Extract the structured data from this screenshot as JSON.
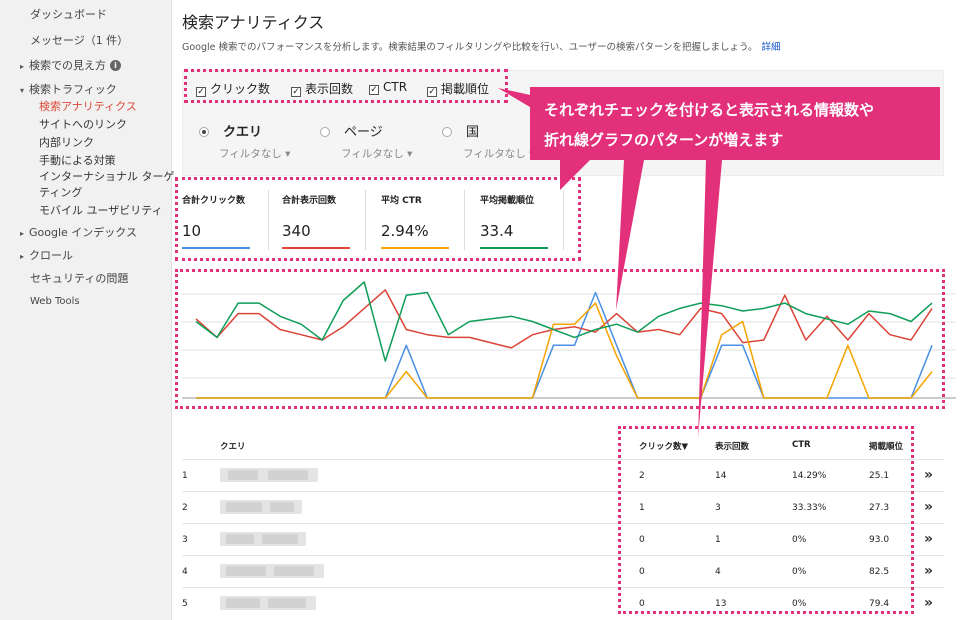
{
  "sidebar": {
    "items": [
      {
        "label": "ダッシュボード"
      },
      {
        "label": "メッセージ（1 件）"
      },
      {
        "label": "検索での見え方"
      },
      {
        "label": "検索トラフィック"
      },
      {
        "label": "検索アナリティクス"
      },
      {
        "label": "サイトへのリンク"
      },
      {
        "label": "内部リンク"
      },
      {
        "label": "手動による対策"
      },
      {
        "label": "インターナショナル ターゲ"
      },
      {
        "label": "ティング"
      },
      {
        "label": "モバイル ユーザビリティ"
      },
      {
        "label": "Google インデックス"
      },
      {
        "label": "クロール"
      },
      {
        "label": "セキュリティの問題"
      },
      {
        "label": "Web Tools"
      }
    ],
    "arrow_right": "▸",
    "arrow_down": "▾",
    "info_glyph": "i"
  },
  "header": {
    "title": "検索アナリティクス",
    "description": "Google 検索でのパフォーマンスを分析します。検索結果のフィルタリングや比較を行い、ユーザーの検索パターンを把握しましょう。",
    "details_link": "詳細"
  },
  "metrics": [
    {
      "label": "クリック数",
      "checked": true
    },
    {
      "label": "表示回数",
      "checked": true
    },
    {
      "label": "CTR",
      "checked": true
    },
    {
      "label": "掲載順位",
      "checked": true
    }
  ],
  "check_glyph": "✓",
  "dimensions": [
    {
      "label": "クエリ",
      "selected": true,
      "filter": "フィルタなし ▾"
    },
    {
      "label": "ページ",
      "selected": false,
      "filter": "フィルタなし ▾"
    },
    {
      "label": "国",
      "selected": false,
      "filter": "フィルタなし ▾"
    }
  ],
  "totals": [
    {
      "label": "合計クリック数",
      "value": "10",
      "color": "#4a90e2"
    },
    {
      "label": "合計表示回数",
      "value": "340",
      "color": "#db4437"
    },
    {
      "label": "平均 CTR",
      "value": "2.94%",
      "color": "#f4a300"
    },
    {
      "label": "平均掲載順位",
      "value": "33.4",
      "color": "#0f9d58"
    }
  ],
  "chart_data": {
    "type": "line",
    "grid": true,
    "series": [
      {
        "color": "#4a90e2",
        "values": [
          0,
          0,
          0,
          0,
          0,
          0,
          0,
          0,
          0,
          0,
          2,
          0,
          0,
          0,
          0,
          0,
          0,
          2,
          2,
          4,
          2,
          0,
          0,
          0,
          0,
          2,
          2,
          0,
          0,
          0,
          0,
          0,
          0,
          0,
          0,
          2
        ]
      },
      {
        "color": "#db4437",
        "values": [
          3,
          2.3,
          3.2,
          3.2,
          2.6,
          2.4,
          2.2,
          2.7,
          3.4,
          4.1,
          2.6,
          2.4,
          2.3,
          2.3,
          2.1,
          1.9,
          2.4,
          2.6,
          2.7,
          2.5,
          3.2,
          2.5,
          2.6,
          2.4,
          3.4,
          3.2,
          2.1,
          2.2,
          3.9,
          2.2,
          3.1,
          2.2,
          3.2,
          2.4,
          2.2,
          3.4
        ]
      },
      {
        "color": "#f4a300",
        "values": [
          0,
          0,
          0,
          0,
          0,
          0,
          0,
          0,
          0,
          0,
          1,
          0,
          0,
          0,
          0,
          0,
          0,
          2.8,
          2.8,
          3.6,
          1.6,
          0,
          0,
          0,
          0,
          2.4,
          2.9,
          0,
          0,
          0,
          0,
          2,
          0,
          0,
          0,
          1
        ]
      },
      {
        "color": "#0f9d58",
        "values": [
          2.9,
          2.3,
          3.6,
          3.6,
          3.1,
          2.8,
          2.2,
          3.7,
          4.4,
          1.4,
          3.9,
          4.0,
          2.4,
          2.9,
          3.0,
          3.1,
          2.9,
          2.6,
          2.3,
          2.6,
          2.8,
          2.5,
          3.1,
          3.4,
          3.6,
          3.5,
          3.3,
          3.4,
          3.6,
          3.2,
          3.0,
          2.8,
          3.3,
          3.2,
          2.9,
          3.6
        ]
      }
    ]
  },
  "table": {
    "headers": {
      "query": "クエリ",
      "clicks": "クリック数▼",
      "impressions": "表示回数",
      "ctr": "CTR",
      "position": "掲載順位"
    },
    "rows": [
      {
        "num": "1",
        "clicks": "2",
        "impressions": "14",
        "ctr": "14.29%",
        "position": "25.1"
      },
      {
        "num": "2",
        "clicks": "1",
        "impressions": "3",
        "ctr": "33.33%",
        "position": "27.3"
      },
      {
        "num": "3",
        "clicks": "0",
        "impressions": "1",
        "ctr": "0%",
        "position": "93.0"
      },
      {
        "num": "4",
        "clicks": "0",
        "impressions": "4",
        "ctr": "0%",
        "position": "82.5"
      },
      {
        "num": "5",
        "clicks": "0",
        "impressions": "13",
        "ctr": "0%",
        "position": "79.4"
      }
    ],
    "row_chevron": "»"
  },
  "annotation": {
    "line1": "それぞれチェックを付けると表示される情報数や",
    "line2": "折れ線グラフのパターンが増えます",
    "color": "#e2307a"
  }
}
